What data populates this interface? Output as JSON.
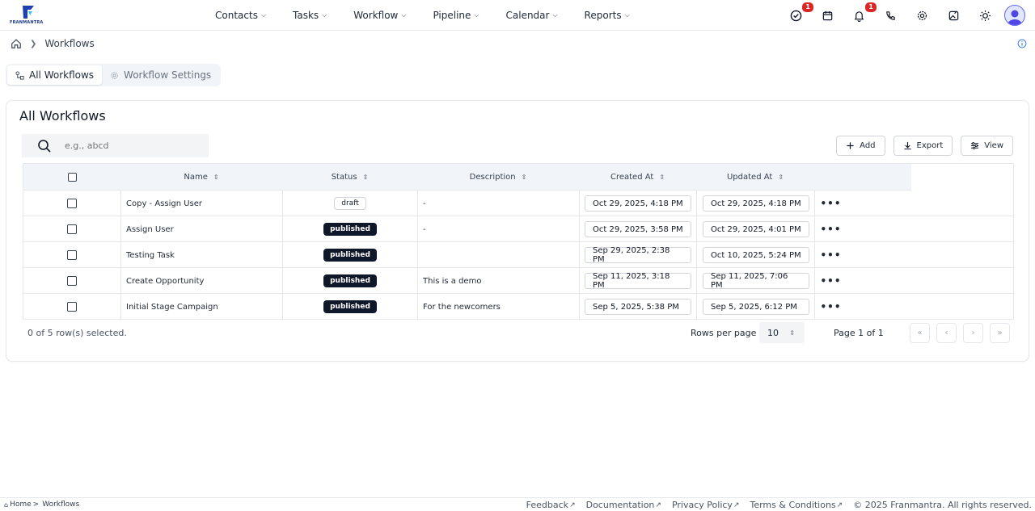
{
  "brand": {
    "name": "FRANMANTRA"
  },
  "nav": {
    "menu": [
      {
        "label": "Contacts"
      },
      {
        "label": "Tasks"
      },
      {
        "label": "Workflow"
      },
      {
        "label": "Pipeline"
      },
      {
        "label": "Calendar"
      },
      {
        "label": "Reports"
      }
    ],
    "tasks_badge": "1",
    "notifications_badge": "1"
  },
  "breadcrumb": {
    "current": "Workflows"
  },
  "tabs": [
    {
      "label": "All Workflows",
      "active": true
    },
    {
      "label": "Workflow Settings",
      "active": false
    }
  ],
  "card": {
    "title": "All Workflows",
    "search_placeholder": "e.g., abcd",
    "buttons": {
      "add": "Add",
      "export": "Export",
      "view": "View"
    }
  },
  "table": {
    "columns": [
      "Name",
      "Status",
      "Description",
      "Created At",
      "Updated At"
    ],
    "rows": [
      {
        "name": "Copy - Assign User",
        "status": "draft",
        "description": "-",
        "created": "Oct 29, 2025, 4:18 PM",
        "updated": "Oct 29, 2025, 4:18 PM"
      },
      {
        "name": "Assign User",
        "status": "published",
        "description": "-",
        "created": "Oct 29, 2025, 3:58 PM",
        "updated": "Oct 29, 2025, 4:01 PM"
      },
      {
        "name": "Testing Task",
        "status": "published",
        "description": "",
        "created": "Sep 29, 2025, 2:38 PM",
        "updated": "Oct 10, 2025, 5:24 PM"
      },
      {
        "name": "Create Opportunity",
        "status": "published",
        "description": "This is a demo",
        "created": "Sep 11, 2025, 3:18 PM",
        "updated": "Sep 11, 2025, 7:06 PM"
      },
      {
        "name": "Initial Stage Campaign",
        "status": "published",
        "description": "For the newcomers",
        "created": "Sep 5, 2025, 5:38 PM",
        "updated": "Sep 5, 2025, 6:12 PM"
      }
    ],
    "row_action": "•••"
  },
  "pagination": {
    "selected_text": "0 of 5 row(s) selected.",
    "rows_per_page_label": "Rows per page",
    "rows_per_page": "10",
    "page_text": "Page 1 of 1"
  },
  "footer": {
    "breadcrumb_home": "Home",
    "breadcrumb_current": "Workflows",
    "links": [
      "Feedback",
      "Documentation",
      "Privacy Policy",
      "Terms & Conditions"
    ],
    "copyright": "© 2025 Franmantra. All rights reserved."
  },
  "colors": {
    "accent": "#0f172a",
    "badge": "#dc2626",
    "brand": "#1e3a8a"
  }
}
